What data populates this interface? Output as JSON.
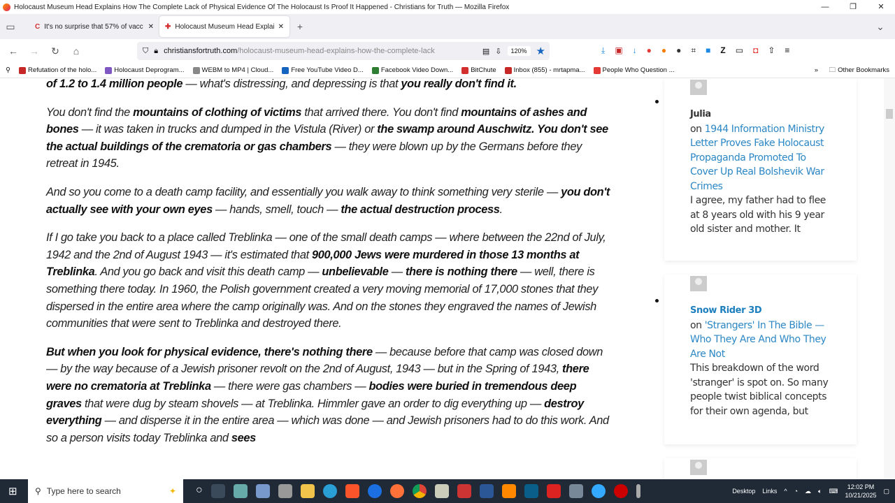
{
  "window": {
    "title": "Holocaust Museum Head Explains How The Complete Lack of Physical Evidence Of The Holocaust Is Proof It Happened - Christians for Truth — Mozilla Firefox",
    "min": "—",
    "max": "❐",
    "close": "✕"
  },
  "tabs": [
    {
      "label": "It's no surprise that 57% of vacc",
      "icon": "C",
      "color": "#d32f2f"
    },
    {
      "label": "Holocaust Museum Head Explains",
      "icon": "✚",
      "color": "#d32f2f"
    }
  ],
  "new_tab": "+",
  "nav": {
    "back": "←",
    "forward": "→",
    "reload": "↻",
    "home": "⌂",
    "url_domain": "christiansfortruth.com",
    "url_path": "/holocaust-museum-head-explains-how-the-complete-lack",
    "zoom": "120%",
    "star": "★"
  },
  "bookmarks": [
    {
      "label": "Refutation of the holo...",
      "color": "#c62828"
    },
    {
      "label": "Holocaust Deprogram...",
      "color": "#7e57c2"
    },
    {
      "label": "WEBM to MP4 | Cloud...",
      "color": "#888888"
    },
    {
      "label": "Free YouTube Video D...",
      "color": "#1565c0"
    },
    {
      "label": "Facebook Video Down...",
      "color": "#2e7d32"
    },
    {
      "label": "BitChute",
      "color": "#d32f2f"
    },
    {
      "label": "Inbox (855) - mrtapma...",
      "color": "#c62828"
    },
    {
      "label": "People Who Question ...",
      "color": "#e53935"
    }
  ],
  "other_bookmarks": "Other Bookmarks",
  "article": [
    [
      {
        "t": "of 1.2 to 1.4 million people",
        "b": true
      },
      {
        "t": " — what's distressing, and depressing is that "
      },
      {
        "t": "you really don't find it.",
        "b": true
      }
    ],
    [
      {
        "t": "You don't find the "
      },
      {
        "t": "mountains of clothing of victims",
        "b": true
      },
      {
        "t": " that arrived there.  You don't find "
      },
      {
        "t": "mountains of ashes and bones",
        "b": true
      },
      {
        "t": " — it was taken in trucks and dumped in the Vistula (River) or "
      },
      {
        "t": "the swamp around Auschwitz.  You don't see the actual buildings of the crematoria or gas chambers",
        "b": true
      },
      {
        "t": " — they were blown up by the Germans before they retreat in 1945."
      }
    ],
    [
      {
        "t": "And so you come to a death camp facility, and essentially you walk away to think something very sterile — "
      },
      {
        "t": "you don't actually see with your own eyes",
        "b": true
      },
      {
        "t": " — hands, smell, touch — "
      },
      {
        "t": "the actual destruction process",
        "b": true
      },
      {
        "t": "."
      }
    ],
    [
      {
        "t": "If I go take you back to a place called Treblinka — one of the small death camps — where between the 22nd of July, 1942 and the 2nd of August 1943 — it's estimated that "
      },
      {
        "t": "900,000 Jews were murdered in those 13 months at Treblinka",
        "b": true
      },
      {
        "t": ".  And you go back and visit this death camp — "
      },
      {
        "t": "unbelievable",
        "b": true
      },
      {
        "t": " — "
      },
      {
        "t": "there is nothing there",
        "b": true
      },
      {
        "t": " — well, there is something there today.  In 1960, the Polish government created a very moving memorial of 17,000 stones that they dispersed in the entire area where the camp originally was.  And on the stones they engraved the names of Jewish communities that were sent to Treblinka and destroyed there."
      }
    ],
    [
      {
        "t": "But when you look for physical evidence, there's nothing there",
        "b": true
      },
      {
        "t": " — because before that camp was closed down — by the way because of a Jewish prisoner revolt on the 2nd of August, 1943 — but in the Spring of 1943, "
      },
      {
        "t": "there were no crematoria at Treblinka",
        "b": true
      },
      {
        "t": " — there were gas chambers — "
      },
      {
        "t": "bodies were buried in tremendous deep graves",
        "b": true
      },
      {
        "t": " that were dug by steam shovels — at Treblinka.  Himmler gave an order to dig everything up — "
      },
      {
        "t": "destroy everything",
        "b": true
      },
      {
        "t": " — and disperse it in the entire area — which was done — and Jewish prisoners had to do this work.  And so a person visits today Treblinka and "
      },
      {
        "t": "sees",
        "b": true
      }
    ]
  ],
  "comments": [
    {
      "author": "Julia",
      "on": "on ",
      "link": "1944 Information Ministry Letter Proves Fake Holocaust Propaganda Promoted To Cover Up Real Bolshevik War Crimes",
      "excerpt": "I agree, my father had to flee at 8 years old with his 9 year old sister and mother. It"
    },
    {
      "author": "Snow Rider 3D",
      "on": "on ",
      "link": "'Strangers' In The Bible — Who They Are And Who They Are Not",
      "excerpt": "This breakdown of the word 'stranger' is spot on. So many people twist biblical concepts for their own agenda, but"
    }
  ],
  "taskbar": {
    "search_placeholder": "Type here to search",
    "desktop": "Desktop",
    "links": "Links",
    "time": "12:02 PM",
    "date": "10/21/2025"
  }
}
